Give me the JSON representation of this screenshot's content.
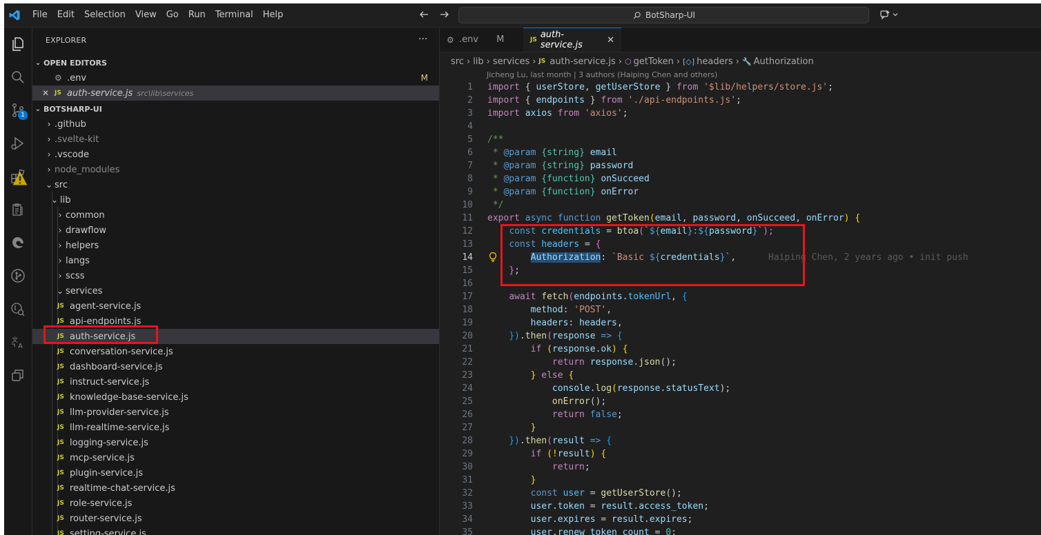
{
  "titlebar": {
    "menu": [
      "File",
      "Edit",
      "Selection",
      "View",
      "Go",
      "Run",
      "Terminal",
      "Help"
    ],
    "search_text": "BotSharp-UI"
  },
  "activity": {
    "scm_badge": "1"
  },
  "sidebar": {
    "title": "EXPLORER",
    "more": "···",
    "open_editors_header": "OPEN EDITORS",
    "open_editors": [
      {
        "name": ".env",
        "status": "M"
      },
      {
        "name": "auth-service.js",
        "path": "src\\lib\\services"
      }
    ],
    "project_header": "BOTSHARP-UI",
    "tree": [
      {
        "name": ".github"
      },
      {
        "name": ".svelte-kit"
      },
      {
        "name": ".vscode"
      },
      {
        "name": "node_modules"
      },
      {
        "name": "src"
      },
      {
        "name": "lib"
      },
      {
        "name": "common"
      },
      {
        "name": "drawflow"
      },
      {
        "name": "helpers"
      },
      {
        "name": "langs"
      },
      {
        "name": "scss"
      },
      {
        "name": "services"
      },
      {
        "name": "agent-service.js"
      },
      {
        "name": "api-endpoints.js"
      },
      {
        "name": "auth-service.js"
      },
      {
        "name": "conversation-service.js"
      },
      {
        "name": "dashboard-service.js"
      },
      {
        "name": "instruct-service.js"
      },
      {
        "name": "knowledge-base-service.js"
      },
      {
        "name": "llm-provider-service.js"
      },
      {
        "name": "llm-realtime-service.js"
      },
      {
        "name": "logging-service.js"
      },
      {
        "name": "mcp-service.js"
      },
      {
        "name": "plugin-service.js"
      },
      {
        "name": "realtime-chat-service.js"
      },
      {
        "name": "role-service.js"
      },
      {
        "name": "router-service.js"
      },
      {
        "name": "setting-service.js"
      }
    ]
  },
  "editor": {
    "tabs": [
      {
        "label": ".env",
        "status": "M"
      },
      {
        "label": "auth-service.js"
      }
    ],
    "breadcrumbs": [
      "src",
      "lib",
      "services",
      "auth-service.js",
      "getToken",
      "headers",
      "Authorization"
    ],
    "blame_header": "Jicheng Lu, last month | 3 authors (Haiping Chen and others)",
    "inline_blame": "Haiping Chen, 2 years ago • init push",
    "line_numbers": [
      "1",
      "2",
      "3",
      "4",
      "5",
      "6",
      "7",
      "8",
      "9",
      "10",
      "11",
      "12",
      "13",
      "14",
      "15",
      "16",
      "17",
      "18",
      "19",
      "20",
      "21",
      "22",
      "23",
      "24",
      "25",
      "26",
      "27",
      "28",
      "29",
      "30",
      "31",
      "32",
      "33",
      "34",
      "35"
    ],
    "code": {
      "l1": [
        "import",
        " { ",
        "userStore",
        ", ",
        "getUserStore",
        " } ",
        "from",
        " ",
        "'$lib/helpers/store.js'",
        ";"
      ],
      "l2": [
        "import",
        " { ",
        "endpoints",
        " } ",
        "from",
        " ",
        "'./api-endpoints.js'",
        ";"
      ],
      "l3": [
        "import",
        " ",
        "axios",
        " ",
        "from",
        " ",
        "'axios'",
        ";"
      ],
      "l5": "/**",
      "l6": [
        " * ",
        "@param",
        " ",
        "{string}",
        " ",
        "email"
      ],
      "l7": [
        " * ",
        "@param",
        " ",
        "{string}",
        " ",
        "password"
      ],
      "l8": [
        " * ",
        "@param",
        " ",
        "{function}",
        " ",
        "onSucceed"
      ],
      "l9": [
        " * ",
        "@param",
        " ",
        "{function}",
        " ",
        "onError"
      ],
      "l10": " */",
      "l11": [
        "export",
        " ",
        "async",
        " ",
        "function",
        " ",
        "getToken",
        "(",
        "email",
        ", ",
        "password",
        ", ",
        "onSucceed",
        ", ",
        "onError",
        ") ",
        "{"
      ],
      "l12": [
        "const",
        " ",
        "credentials",
        " = ",
        "btoa",
        "(",
        "`",
        "${",
        "email",
        "}",
        ":",
        "${",
        "password",
        "}",
        "`",
        ");"
      ],
      "l13": [
        "const",
        " ",
        "headers",
        " = ",
        "{"
      ],
      "l14": [
        "Authorization",
        ": ",
        "`Basic ",
        "${",
        "credentials",
        "}",
        "`",
        ","
      ],
      "l15": [
        "}",
        ";"
      ],
      "l17": [
        "await",
        " ",
        "fetch",
        "(",
        "endpoints",
        ".",
        "tokenUrl",
        ", ",
        "{"
      ],
      "l18": [
        "method",
        ": ",
        "'POST'",
        ","
      ],
      "l19": [
        "headers",
        ": ",
        "headers",
        ","
      ],
      "l20": [
        "})",
        ".",
        "then",
        "(",
        "response",
        " => ",
        "{"
      ],
      "l21": [
        "if",
        " (",
        "response",
        ".",
        "ok",
        ") ",
        "{"
      ],
      "l22": [
        "return",
        " ",
        "response",
        ".",
        "json",
        "();"
      ],
      "l23": [
        "}",
        " ",
        "else",
        " ",
        "{"
      ],
      "l24": [
        "console",
        ".",
        "log",
        "(",
        "response",
        ".",
        "statusText",
        ");"
      ],
      "l25": [
        "onError",
        "();"
      ],
      "l26": [
        "return",
        " ",
        "false",
        ";"
      ],
      "l27": [
        "}"
      ],
      "l28": [
        "})",
        ".",
        "then",
        "(",
        "result",
        " => ",
        "{"
      ],
      "l29": [
        "if",
        " (!",
        "result",
        ") ",
        "{"
      ],
      "l30": [
        "return",
        ";"
      ],
      "l31": [
        "}"
      ],
      "l32": [
        "const",
        " ",
        "user",
        " = ",
        "getUserStore",
        "();"
      ],
      "l33": [
        "user",
        ".",
        "token",
        " = ",
        "result",
        ".",
        "access_token",
        ";"
      ],
      "l34": [
        "user",
        ".",
        "expires",
        " = ",
        "result",
        ".",
        "expires",
        ";"
      ],
      "l35": [
        "user",
        ".",
        "renew_token_count",
        " = ",
        "0",
        ";"
      ]
    }
  },
  "colors": {
    "accent": "#0078d4",
    "highlight_box": "#e5161c",
    "js_icon": "#cbcb41",
    "modified": "#e2c08d"
  }
}
